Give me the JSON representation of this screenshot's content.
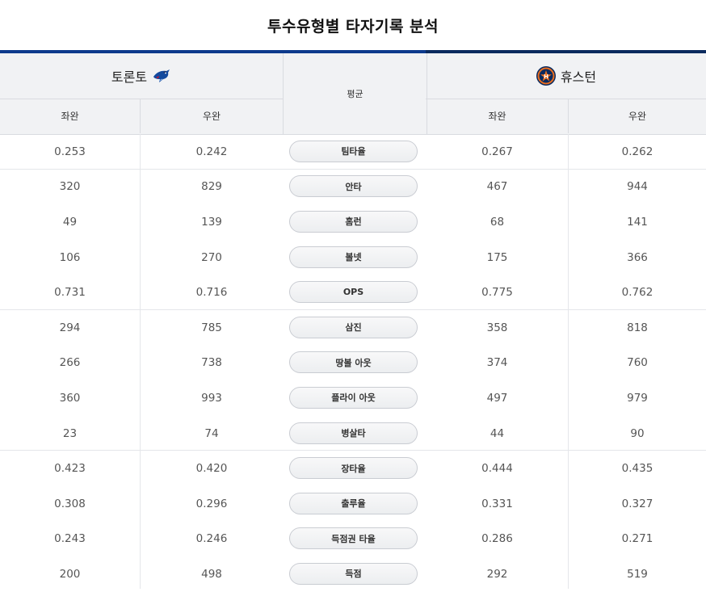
{
  "title": "투수유형별 타자기록 분석",
  "teams": {
    "left": {
      "name": "토론토",
      "logo": "blue-jays-logo"
    },
    "right": {
      "name": "휴스턴",
      "logo": "astros-logo"
    }
  },
  "header": {
    "avg_label": "평균",
    "left_lhp": "좌완",
    "left_rhp": "우완",
    "right_lhp": "좌완",
    "right_rhp": "우완"
  },
  "colors": {
    "accent_left": "#0d3a8c",
    "accent_right": "#0a2a5e"
  },
  "rows": [
    {
      "label": "팀타율",
      "tor_l": "0.253",
      "tor_r": "0.242",
      "hou_l": "0.267",
      "hou_r": "0.262"
    },
    {
      "label": "안타",
      "tor_l": "320",
      "tor_r": "829",
      "hou_l": "467",
      "hou_r": "944"
    },
    {
      "label": "홈런",
      "tor_l": "49",
      "tor_r": "139",
      "hou_l": "68",
      "hou_r": "141"
    },
    {
      "label": "볼넷",
      "tor_l": "106",
      "tor_r": "270",
      "hou_l": "175",
      "hou_r": "366"
    },
    {
      "label": "OPS",
      "tor_l": "0.731",
      "tor_r": "0.716",
      "hou_l": "0.775",
      "hou_r": "0.762"
    },
    {
      "label": "삼진",
      "tor_l": "294",
      "tor_r": "785",
      "hou_l": "358",
      "hou_r": "818"
    },
    {
      "label": "땅볼 아웃",
      "tor_l": "266",
      "tor_r": "738",
      "hou_l": "374",
      "hou_r": "760"
    },
    {
      "label": "플라이 아웃",
      "tor_l": "360",
      "tor_r": "993",
      "hou_l": "497",
      "hou_r": "979"
    },
    {
      "label": "병살타",
      "tor_l": "23",
      "tor_r": "74",
      "hou_l": "44",
      "hou_r": "90"
    },
    {
      "label": "장타율",
      "tor_l": "0.423",
      "tor_r": "0.420",
      "hou_l": "0.444",
      "hou_r": "0.435"
    },
    {
      "label": "출루율",
      "tor_l": "0.308",
      "tor_r": "0.296",
      "hou_l": "0.331",
      "hou_r": "0.327"
    },
    {
      "label": "득점권 타율",
      "tor_l": "0.243",
      "tor_r": "0.246",
      "hou_l": "0.286",
      "hou_r": "0.271"
    },
    {
      "label": "득점",
      "tor_l": "200",
      "tor_r": "498",
      "hou_l": "292",
      "hou_r": "519"
    }
  ]
}
